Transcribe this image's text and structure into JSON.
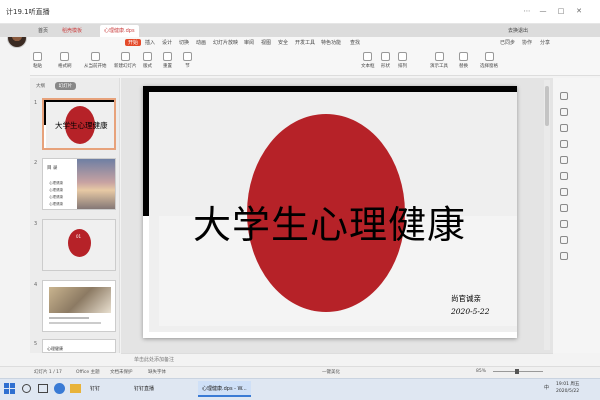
{
  "live": {
    "title": "计19.1听直播",
    "controls": [
      "⋯",
      "—",
      "□",
      "✕"
    ]
  },
  "wps_tabs": {
    "home": "首页",
    "tab1": "稻壳模板",
    "tab2": "心理健康.dps",
    "account": "去换退出"
  },
  "menu": [
    "开始",
    "插入",
    "设计",
    "切换",
    "动画",
    "幻灯片放映",
    "审阅",
    "视图",
    "安全",
    "开发工具",
    "特色功能",
    "查找"
  ],
  "menu_selected": "开始",
  "share": [
    "已同步",
    "协作",
    "分享"
  ],
  "toolbar": [
    "粘贴",
    "格式刷",
    "从当前开始",
    "新建幻灯片",
    "版式",
    "重置",
    "节",
    "文本框",
    "形状",
    "排列",
    "演示工具",
    "替换",
    "选择窗格"
  ],
  "left_panel": {
    "tabs": [
      "大纲",
      "幻灯片"
    ],
    "active_tab": "幻灯片",
    "thumb1_title": "大学生心理健康",
    "thumb2_title": "目 录",
    "thumb2_items": [
      "心理健康",
      "心理健康",
      "心理健康",
      "心理健康"
    ],
    "thumb3_number": "01",
    "thumb5_label": "心理健康"
  },
  "slide": {
    "title": "大学生心理健康",
    "author": "尚官诚亲",
    "date": "2020-5-22",
    "circle_color": "#b62228"
  },
  "notes_placeholder": "单击此处添加备注",
  "status": {
    "slide_info": "幻灯片 1 / 17",
    "theme": "Office 主题",
    "backup": "文档未保护",
    "font_missing": "缺失字体",
    "beautify": "一键美化",
    "zoom": "85%"
  },
  "taskbar": {
    "apps": [
      "钉钉",
      "钉钉直播",
      "心理健康.dps - W..."
    ],
    "tray_time": "19:01 周五",
    "tray_date": "2020/5/22",
    "tray_lang": "中"
  },
  "colors": {
    "accent": "#e44a2a",
    "slide_red": "#b62228"
  }
}
